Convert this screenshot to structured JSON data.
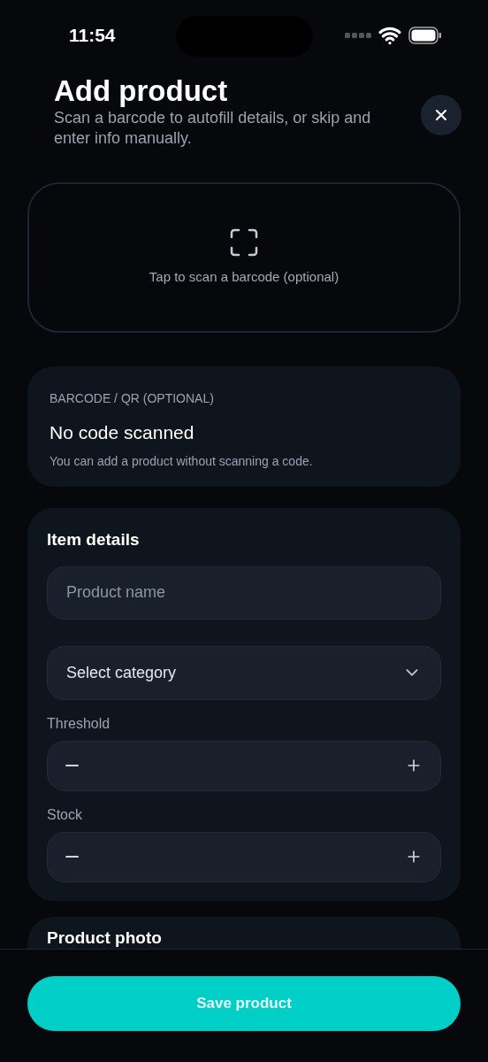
{
  "status_bar": {
    "time": "11:54"
  },
  "header": {
    "title": "Add product",
    "subtitle": "Scan a barcode to autofill details, or skip and enter info manually."
  },
  "scan_area": {
    "label": "Tap to scan a barcode (optional)"
  },
  "barcode_card": {
    "label": "BARCODE / QR (OPTIONAL)",
    "value": "No code scanned",
    "hint": "You can add a product without scanning a code."
  },
  "item_details": {
    "title": "Item details",
    "product_name": {
      "placeholder": "Product name"
    },
    "category": {
      "value": "Select category"
    },
    "steppers": [
      {
        "label": "Threshold"
      },
      {
        "label": "Stock"
      }
    ]
  },
  "photo_card": {
    "title": "Product photo"
  },
  "save_button": "Save product"
}
